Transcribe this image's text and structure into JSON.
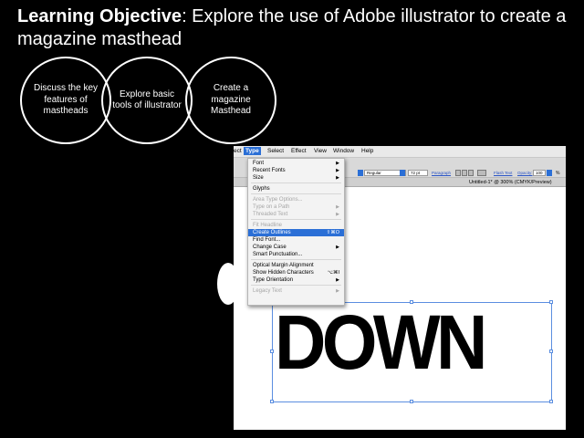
{
  "header": {
    "label": "Learning Objective",
    "text": ": Explore the use of Adobe illustrator to create a magazine masthead"
  },
  "circles": [
    "Discuss the key features of mastheads",
    "Explore basic tools of illustrator",
    "Create a magazine Masthead"
  ],
  "app": {
    "menubar": [
      "ect",
      "Type",
      "Select",
      "Effect",
      "View",
      "Window",
      "Help"
    ],
    "control_bar": {
      "font_style": "Regular",
      "font_size": "72 pt",
      "paragraph_link": "Paragraph",
      "flash_text_link": "Flash Text",
      "opacity_label": "Opacity:",
      "opacity_value": "100",
      "percent": "%"
    },
    "document_title": "Untitled-1* @ 300% (CMYK/Preview)",
    "type_menu": [
      {
        "label": "Font",
        "submenu": true,
        "disabled": false
      },
      {
        "label": "Recent Fonts",
        "submenu": true,
        "disabled": false
      },
      {
        "label": "Size",
        "submenu": true,
        "disabled": false
      },
      {
        "label": "Glyphs",
        "disabled": false
      },
      {
        "label": "Area Type Options...",
        "disabled": true
      },
      {
        "label": "Type on a Path",
        "submenu": true,
        "disabled": true
      },
      {
        "label": "Threaded Text",
        "submenu": true,
        "disabled": true
      },
      {
        "label": "Fit Headline",
        "disabled": true
      },
      {
        "label": "Create Outlines",
        "shortcut": "⇧⌘O",
        "highlighted": true
      },
      {
        "label": "Find Font...",
        "disabled": false
      },
      {
        "label": "Change Case",
        "submenu": true,
        "disabled": false
      },
      {
        "label": "Smart Punctuation...",
        "disabled": false
      },
      {
        "label": "Optical Margin Alignment",
        "disabled": false
      },
      {
        "label": "Show Hidden Characters",
        "shortcut": "⌥⌘I",
        "disabled": false
      },
      {
        "label": "Type Orientation",
        "submenu": true,
        "disabled": false
      },
      {
        "label": "Legacy Text",
        "submenu": true,
        "disabled": true
      }
    ],
    "canvas_text": "DOWN"
  },
  "colors": {
    "background": "#000000",
    "menu_highlight": "#2b6fd6",
    "selection": "#5b8ee0"
  }
}
